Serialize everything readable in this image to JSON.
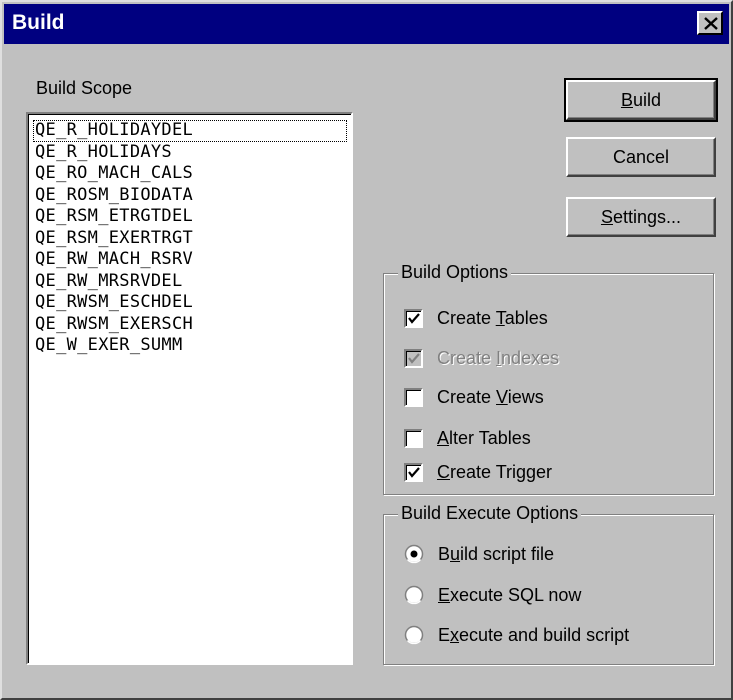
{
  "window": {
    "title": "Build"
  },
  "scope": {
    "label": "Build Scope",
    "items": [
      "QE_R_HOLIDAYDEL",
      "QE_R_HOLIDAYS",
      "QE_RO_MACH_CALS",
      "QE_ROSM_BIODATA",
      "QE_RSM_ETRGTDEL",
      "QE_RSM_EXERTRGT",
      "QE_RW_MACH_RSRV",
      "QE_RW_MRSRVDEL",
      "QE_RWSM_ESCHDEL",
      "QE_RWSM_EXERSCH",
      "QE_W_EXER_SUMM"
    ]
  },
  "buttons": {
    "build": {
      "accel": "B",
      "rest": "uild"
    },
    "cancel": "Cancel",
    "settings": {
      "accel": "S",
      "rest": "ettings..."
    }
  },
  "build_options": {
    "title": "Build Options",
    "items": [
      {
        "pre": "Create ",
        "accel": "T",
        "post": "ables",
        "checked": true,
        "enabled": true
      },
      {
        "pre": "Create ",
        "accel": "I",
        "post": "ndexes",
        "checked": true,
        "enabled": false
      },
      {
        "pre": "Create ",
        "accel": "V",
        "post": "iews",
        "checked": false,
        "enabled": true
      },
      {
        "pre": "",
        "accel": "A",
        "post": "lter Tables",
        "checked": false,
        "enabled": true
      },
      {
        "pre": "",
        "accel": "C",
        "post": "reate Trigger",
        "checked": true,
        "enabled": true
      }
    ]
  },
  "execute_options": {
    "title": "Build Execute Options",
    "items": [
      {
        "pre": "B",
        "accel": "u",
        "post": "ild script file",
        "selected": true
      },
      {
        "pre": "",
        "accel": "E",
        "post": "xecute SQL now",
        "selected": false
      },
      {
        "pre": "E",
        "accel": "x",
        "post": "ecute and build script",
        "selected": false
      }
    ]
  }
}
